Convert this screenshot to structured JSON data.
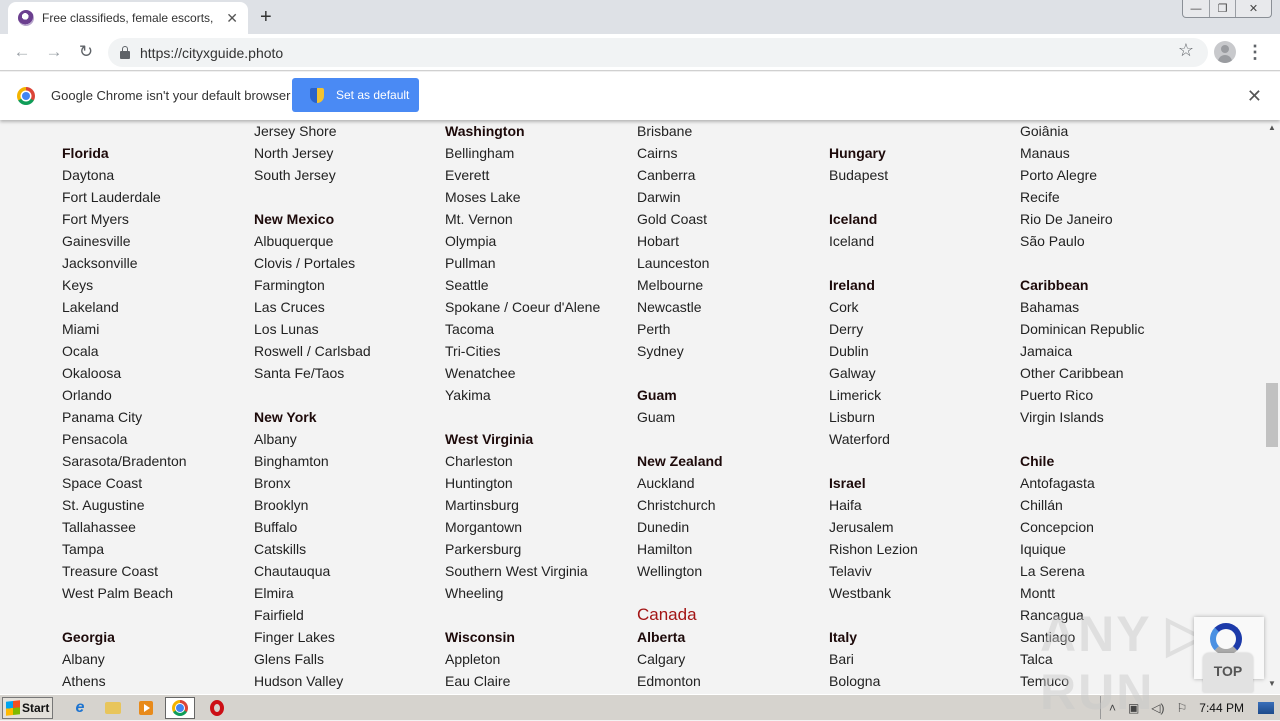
{
  "browser": {
    "tab": {
      "title": "Free classifieds, female escorts, female escorts"
    },
    "new_tab_label": "+",
    "window_controls": {
      "minimize": "—",
      "restore": "❐",
      "close": "✕"
    },
    "url": "https://cityxguide.photo",
    "infobar": {
      "message": "Google Chrome isn't your default browser",
      "button_label": "Set as default",
      "close": "✕"
    },
    "icons": {
      "back": "←",
      "forward": "→",
      "reload": "↻",
      "star": "☆",
      "menu": "⋮",
      "close": "✕"
    }
  },
  "columns": [
    [
      {
        "t": "blank",
        "v": ""
      },
      {
        "t": "head",
        "v": "Florida"
      },
      {
        "t": "link",
        "v": "Daytona"
      },
      {
        "t": "link",
        "v": "Fort Lauderdale"
      },
      {
        "t": "link",
        "v": "Fort Myers"
      },
      {
        "t": "link",
        "v": "Gainesville"
      },
      {
        "t": "link",
        "v": "Jacksonville"
      },
      {
        "t": "link",
        "v": "Keys"
      },
      {
        "t": "link",
        "v": "Lakeland"
      },
      {
        "t": "link",
        "v": "Miami"
      },
      {
        "t": "link",
        "v": "Ocala"
      },
      {
        "t": "link",
        "v": "Okaloosa"
      },
      {
        "t": "link",
        "v": "Orlando"
      },
      {
        "t": "link",
        "v": "Panama City"
      },
      {
        "t": "link",
        "v": "Pensacola"
      },
      {
        "t": "link",
        "v": "Sarasota/Bradenton"
      },
      {
        "t": "link",
        "v": "Space Coast"
      },
      {
        "t": "link",
        "v": "St. Augustine"
      },
      {
        "t": "link",
        "v": "Tallahassee"
      },
      {
        "t": "link",
        "v": "Tampa"
      },
      {
        "t": "link",
        "v": "Treasure Coast"
      },
      {
        "t": "link",
        "v": "West Palm Beach"
      },
      {
        "t": "blank",
        "v": ""
      },
      {
        "t": "head",
        "v": "Georgia"
      },
      {
        "t": "link",
        "v": "Albany"
      },
      {
        "t": "link",
        "v": "Athens"
      }
    ],
    [
      {
        "t": "link",
        "v": "Jersey Shore"
      },
      {
        "t": "link",
        "v": "North Jersey"
      },
      {
        "t": "link",
        "v": "South Jersey"
      },
      {
        "t": "blank",
        "v": ""
      },
      {
        "t": "head",
        "v": "New Mexico"
      },
      {
        "t": "link",
        "v": "Albuquerque"
      },
      {
        "t": "link",
        "v": "Clovis / Portales"
      },
      {
        "t": "link",
        "v": "Farmington"
      },
      {
        "t": "link",
        "v": "Las Cruces"
      },
      {
        "t": "link",
        "v": "Los Lunas"
      },
      {
        "t": "link",
        "v": "Roswell / Carlsbad"
      },
      {
        "t": "link",
        "v": "Santa Fe/Taos"
      },
      {
        "t": "blank",
        "v": ""
      },
      {
        "t": "head",
        "v": "New York"
      },
      {
        "t": "link",
        "v": "Albany"
      },
      {
        "t": "link",
        "v": "Binghamton"
      },
      {
        "t": "link",
        "v": "Bronx"
      },
      {
        "t": "link",
        "v": "Brooklyn"
      },
      {
        "t": "link",
        "v": "Buffalo"
      },
      {
        "t": "link",
        "v": "Catskills"
      },
      {
        "t": "link",
        "v": "Chautauqua"
      },
      {
        "t": "link",
        "v": "Elmira"
      },
      {
        "t": "link",
        "v": "Fairfield"
      },
      {
        "t": "link",
        "v": "Finger Lakes"
      },
      {
        "t": "link",
        "v": "Glens Falls"
      },
      {
        "t": "link",
        "v": "Hudson Valley"
      }
    ],
    [
      {
        "t": "head",
        "v": "Washington"
      },
      {
        "t": "link",
        "v": "Bellingham"
      },
      {
        "t": "link",
        "v": "Everett"
      },
      {
        "t": "link",
        "v": "Moses Lake"
      },
      {
        "t": "link",
        "v": "Mt. Vernon"
      },
      {
        "t": "link",
        "v": "Olympia"
      },
      {
        "t": "link",
        "v": "Pullman"
      },
      {
        "t": "link",
        "v": "Seattle"
      },
      {
        "t": "link",
        "v": "Spokane / Coeur d'Alene"
      },
      {
        "t": "link",
        "v": "Tacoma"
      },
      {
        "t": "link",
        "v": "Tri-Cities"
      },
      {
        "t": "link",
        "v": "Wenatchee"
      },
      {
        "t": "link",
        "v": "Yakima"
      },
      {
        "t": "blank",
        "v": ""
      },
      {
        "t": "head",
        "v": "West Virginia"
      },
      {
        "t": "link",
        "v": "Charleston"
      },
      {
        "t": "link",
        "v": "Huntington"
      },
      {
        "t": "link",
        "v": "Martinsburg"
      },
      {
        "t": "link",
        "v": "Morgantown"
      },
      {
        "t": "link",
        "v": "Parkersburg"
      },
      {
        "t": "link",
        "v": "Southern West Virginia"
      },
      {
        "t": "link",
        "v": "Wheeling"
      },
      {
        "t": "blank",
        "v": ""
      },
      {
        "t": "head",
        "v": "Wisconsin"
      },
      {
        "t": "link",
        "v": "Appleton"
      },
      {
        "t": "link",
        "v": "Eau Claire"
      }
    ],
    [
      {
        "t": "link",
        "v": "Brisbane"
      },
      {
        "t": "link",
        "v": "Cairns"
      },
      {
        "t": "link",
        "v": "Canberra"
      },
      {
        "t": "link",
        "v": "Darwin"
      },
      {
        "t": "link",
        "v": "Gold Coast"
      },
      {
        "t": "link",
        "v": "Hobart"
      },
      {
        "t": "link",
        "v": "Launceston"
      },
      {
        "t": "link",
        "v": "Melbourne"
      },
      {
        "t": "link",
        "v": "Newcastle"
      },
      {
        "t": "link",
        "v": "Perth"
      },
      {
        "t": "link",
        "v": "Sydney"
      },
      {
        "t": "blank",
        "v": ""
      },
      {
        "t": "head",
        "v": "Guam"
      },
      {
        "t": "link",
        "v": "Guam"
      },
      {
        "t": "blank",
        "v": ""
      },
      {
        "t": "head",
        "v": "New Zealand"
      },
      {
        "t": "link",
        "v": "Auckland"
      },
      {
        "t": "link",
        "v": "Christchurch"
      },
      {
        "t": "link",
        "v": "Dunedin"
      },
      {
        "t": "link",
        "v": "Hamilton"
      },
      {
        "t": "link",
        "v": "Wellington"
      },
      {
        "t": "blank",
        "v": ""
      },
      {
        "t": "country",
        "v": "Canada"
      },
      {
        "t": "head",
        "v": "Alberta"
      },
      {
        "t": "link",
        "v": "Calgary"
      },
      {
        "t": "link",
        "v": "Edmonton"
      }
    ],
    [
      {
        "t": "blank",
        "v": ""
      },
      {
        "t": "head",
        "v": "Hungary"
      },
      {
        "t": "link",
        "v": "Budapest"
      },
      {
        "t": "blank",
        "v": ""
      },
      {
        "t": "head",
        "v": "Iceland"
      },
      {
        "t": "link",
        "v": "Iceland"
      },
      {
        "t": "blank",
        "v": ""
      },
      {
        "t": "head",
        "v": "Ireland"
      },
      {
        "t": "link",
        "v": "Cork"
      },
      {
        "t": "link",
        "v": "Derry"
      },
      {
        "t": "link",
        "v": "Dublin"
      },
      {
        "t": "link",
        "v": "Galway"
      },
      {
        "t": "link",
        "v": "Limerick"
      },
      {
        "t": "link",
        "v": "Lisburn"
      },
      {
        "t": "link",
        "v": "Waterford"
      },
      {
        "t": "blank",
        "v": ""
      },
      {
        "t": "head",
        "v": "Israel"
      },
      {
        "t": "link",
        "v": "Haifa"
      },
      {
        "t": "link",
        "v": "Jerusalem"
      },
      {
        "t": "link",
        "v": "Rishon Lezion"
      },
      {
        "t": "link",
        "v": "Telaviv"
      },
      {
        "t": "link",
        "v": "Westbank"
      },
      {
        "t": "blank",
        "v": ""
      },
      {
        "t": "head",
        "v": "Italy"
      },
      {
        "t": "link",
        "v": "Bari"
      },
      {
        "t": "link",
        "v": "Bologna"
      }
    ],
    [
      {
        "t": "link",
        "v": "Goiânia"
      },
      {
        "t": "link",
        "v": "Manaus"
      },
      {
        "t": "link",
        "v": "Porto Alegre"
      },
      {
        "t": "link",
        "v": "Recife"
      },
      {
        "t": "link",
        "v": "Rio De Janeiro"
      },
      {
        "t": "link",
        "v": "São Paulo"
      },
      {
        "t": "blank",
        "v": ""
      },
      {
        "t": "head",
        "v": "Caribbean"
      },
      {
        "t": "link",
        "v": "Bahamas"
      },
      {
        "t": "link",
        "v": "Dominican Republic"
      },
      {
        "t": "link",
        "v": "Jamaica"
      },
      {
        "t": "link",
        "v": "Other Caribbean"
      },
      {
        "t": "link",
        "v": "Puerto Rico"
      },
      {
        "t": "link",
        "v": "Virgin Islands"
      },
      {
        "t": "blank",
        "v": ""
      },
      {
        "t": "head",
        "v": "Chile"
      },
      {
        "t": "link",
        "v": "Antofagasta"
      },
      {
        "t": "link",
        "v": "Chillán"
      },
      {
        "t": "link",
        "v": "Concepcion"
      },
      {
        "t": "link",
        "v": "Iquique"
      },
      {
        "t": "link",
        "v": "La Serena"
      },
      {
        "t": "link",
        "v": "Montt"
      },
      {
        "t": "link",
        "v": "Rancagua"
      },
      {
        "t": "link",
        "v": "Santiago"
      },
      {
        "t": "link",
        "v": "Talca"
      },
      {
        "t": "link",
        "v": "Temuco"
      }
    ]
  ],
  "overlays": {
    "top_button": "TOP",
    "watermark": "ANY ▷ RUN"
  },
  "taskbar": {
    "start_label": "Start",
    "clock": "7:44 PM",
    "tray_expand": "˄"
  },
  "colors": {
    "country_heading": "#a31515",
    "set_default_button": "#4a8af4"
  }
}
